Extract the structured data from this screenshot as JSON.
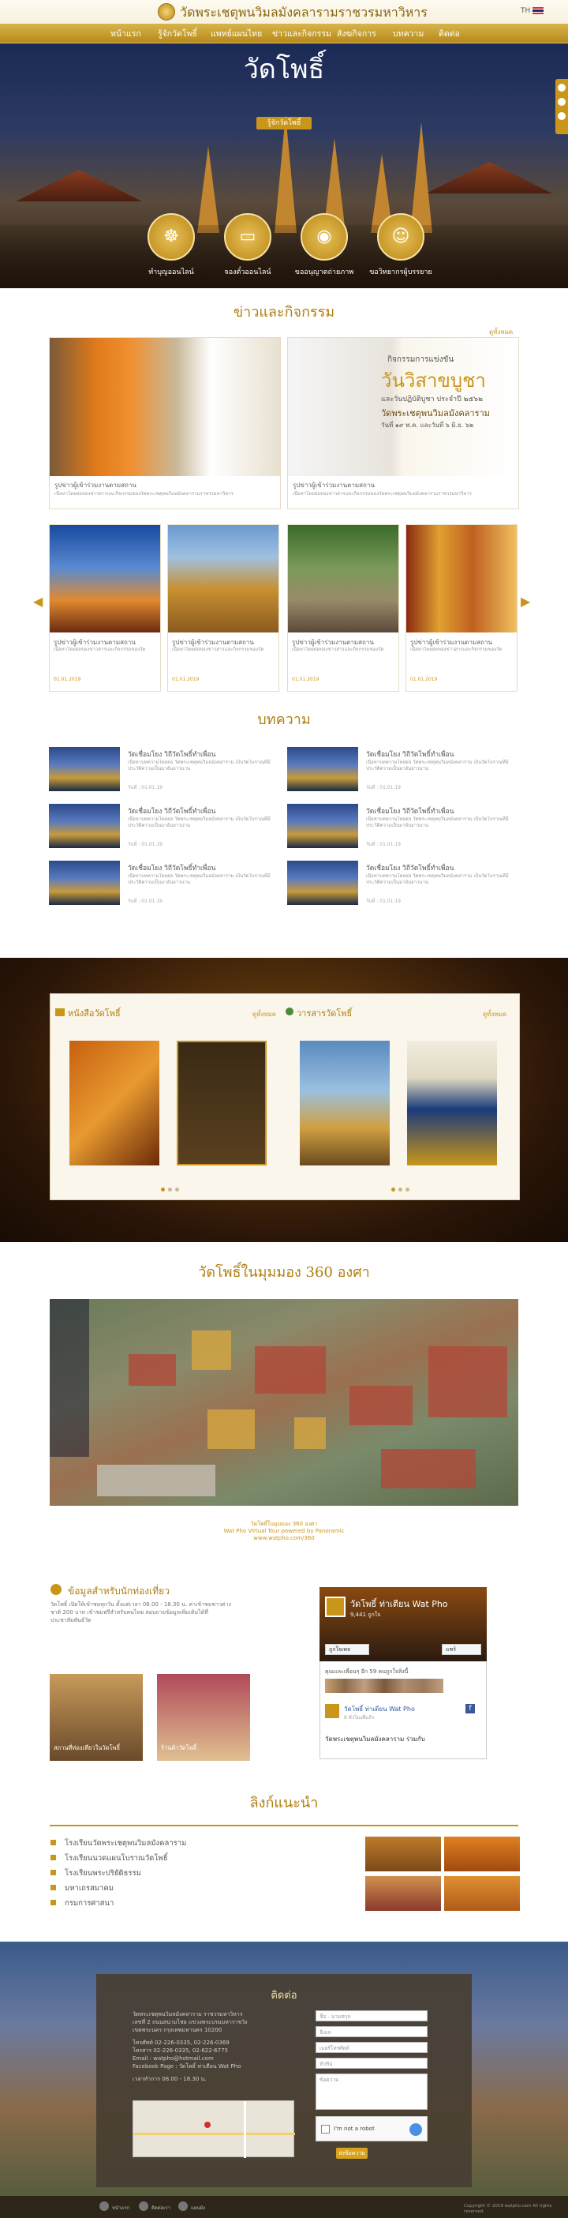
{
  "header": {
    "site_title": "วัดพระเชตุพนวิมลมังคลารามราชวรมหาวิหาร",
    "lang": "TH"
  },
  "nav": [
    "หน้าแรก",
    "รู้จักวัดโพธิ์",
    "แพทย์แผนไทย",
    "ข่าวและกิจกรรม",
    "สังฆกิจการ",
    "บทความ",
    "ติดต่อ"
  ],
  "hero": {
    "title": "วัดโพธิ์",
    "subtitle": "รู้จักวัดโพธิ์",
    "buttons": [
      {
        "label": "ทำบุญออนไลน์",
        "icon": "buddha-icon"
      },
      {
        "label": "จองตั๋วออนไลน์",
        "icon": "ticket-icon"
      },
      {
        "label": "ขออนุญาตถ่ายภาพ",
        "icon": "camera-icon"
      },
      {
        "label": "ขอวิทยากรผู้บรรยาย",
        "icon": "guide-icon"
      }
    ]
  },
  "news": {
    "title": "ข่าวและกิจกรรม",
    "more": "ดูทั้งหมด",
    "featured": [
      {
        "caption": "รูปข่าวผู้เข้าร่วมงานตามสถาน",
        "text": "เนื้อหาโดยย่อของข่าวสารและกิจกรรมของวัดพระเชตุพนวิมลมังคลารามราชวรมหาวิหาร",
        "banner_top": "กิจกรรมการแข่งขัน",
        "banner_main": "วันวิสาขบูชา",
        "banner_sub": "และวันปฏิบัติบูชา ประจำปี ๒๕๖๒",
        "banner_temple": "วัดพระเชตุพนวิมลมังคลาราม",
        "banner_date": "วันที่ ๑๙ พ.ค. และวันที่ ๖ มิ.ย. ๖๒"
      },
      {
        "caption": "รูปข่าวผู้เข้าร่วมงานตามสถาน",
        "text": "เนื้อหาโดยย่อของข่าวสารและกิจกรรมของวัดพระเชตุพนวิมลมังคลารามราชวรมหาวิหาร"
      }
    ],
    "items": [
      {
        "caption": "รูปข่าวผู้เข้าร่วมงานตามสถาน",
        "text": "เนื้อหาโดยย่อของข่าวสารและกิจกรรมของวัด",
        "date": "01.01.2019"
      },
      {
        "caption": "รูปข่าวผู้เข้าร่วมงานตามสถาน",
        "text": "เนื้อหาโดยย่อของข่าวสารและกิจกรรมของวัด",
        "date": "01.01.2019"
      },
      {
        "caption": "รูปข่าวผู้เข้าร่วมงานตามสถาน",
        "text": "เนื้อหาโดยย่อของข่าวสารและกิจกรรมของวัด",
        "date": "01.01.2019"
      },
      {
        "caption": "รูปข่าวผู้เข้าร่วมงานตามสถาน",
        "text": "เนื้อหาโดยย่อของข่าวสารและกิจกรรมของวัด",
        "date": "01.01.2019"
      }
    ]
  },
  "articles": {
    "title": "บทความ",
    "items": [
      {
        "title": "วัดเชื่อมโยง วิถีวัดโพธิ์ทำเพื่อน",
        "text": "เนื้อหาบทความโดยย่อ วัดพระเชตุพนวิมลมังคลาราม เป็นวัดโบราณที่มีประวัติความเป็นมาอันยาวนาน",
        "meta": "วันที่ : 01.01.19"
      },
      {
        "title": "วัดเชื่อมโยง วิถีวัดโพธิ์ทำเพื่อน",
        "text": "เนื้อหาบทความโดยย่อ วัดพระเชตุพนวิมลมังคลาราม เป็นวัดโบราณที่มีประวัติความเป็นมาอันยาวนาน",
        "meta": "วันที่ : 01.01.19"
      },
      {
        "title": "วัดเชื่อมโยง วิถีวัดโพธิ์ทำเพื่อน",
        "text": "เนื้อหาบทความโดยย่อ วัดพระเชตุพนวิมลมังคลาราม เป็นวัดโบราณที่มีประวัติความเป็นมาอันยาวนาน",
        "meta": "วันที่ : 01.01.19"
      },
      {
        "title": "วัดเชื่อมโยง วิถีวัดโพธิ์ทำเพื่อน",
        "text": "เนื้อหาบทความโดยย่อ วัดพระเชตุพนวิมลมังคลาราม เป็นวัดโบราณที่มีประวัติความเป็นมาอันยาวนาน",
        "meta": "วันที่ : 01.01.19"
      },
      {
        "title": "วัดเชื่อมโยง วิถีวัดโพธิ์ทำเพื่อน",
        "text": "เนื้อหาบทความโดยย่อ วัดพระเชตุพนวิมลมังคลาราม เป็นวัดโบราณที่มีประวัติความเป็นมาอันยาวนาน",
        "meta": "วันที่ : 01.01.19"
      },
      {
        "title": "วัดเชื่อมโยง วิถีวัดโพธิ์ทำเพื่อน",
        "text": "เนื้อหาบทความโดยย่อ วัดพระเชตุพนวิมลมังคลาราม เป็นวัดโบราณที่มีประวัติความเป็นมาอันยาวนาน",
        "meta": "วันที่ : 01.01.19"
      }
    ]
  },
  "books": {
    "tab1": "หนังสือวัดโพธิ์",
    "tab2": "วารสารวัดโพธิ์",
    "more": "ดูทั้งหมด"
  },
  "tour360": {
    "title": "วัดโพธิ์ในมุมมอง 360 องศา",
    "note1": "วัดโพธิ์ในมุมมอง 360 องศา",
    "note2": "Wat Pho Virtual Tour powered by Panoramic",
    "note3": "www.watpho.com/360"
  },
  "info": {
    "title": "ข้อมูลสำหรับนักท่องเที่ยว",
    "text": "วัดโพธิ์ เปิดให้เข้าชมทุกวัน ตั้งแต่เวลา 08.00 - 18.30 น. ค่าเข้าชมชาวต่างชาติ 200 บาท เข้าชมฟรีสำหรับคนไทย สอบถามข้อมูลเพิ่มเติมได้ที่ประชาสัมพันธ์วัด",
    "cards": [
      "สถานที่ท่องเที่ยวในวัดโพธิ์",
      "ร้านค้าวัดโพธิ์"
    ]
  },
  "facebook": {
    "page_name": "วัดโพธิ์ ท่าเตียน Wat Pho",
    "likes": "9,441 ถูกใจ",
    "like_btn": "ถูกใจเพจ",
    "share_btn": "แชร์",
    "friends": "คุณและเพื่อนๆ อีก 59 คนถูกใจสิ่งนี้",
    "post_name": "วัดโพธิ์ ท่าเตียน Wat Pho",
    "post_time": "6 ชั่วโมงที่แล้ว",
    "post_text": "วัดพระเชตุพนวิมลมังคลาราม ร่วมกับ"
  },
  "links": {
    "title": "ลิงก์แนะนำ",
    "items": [
      "โรงเรียนวัดพระเชตุพนวิมลมังคลาราม",
      "โรงเรียนนวดแผนโบราณวัดโพธิ์",
      "โรงเรียนพระปริยัติธรรม",
      "มหาเถรสมาคม",
      "กรมการศาสนา"
    ]
  },
  "contact": {
    "title": "ติดต่อ",
    "lines": [
      "วัดพระเชตุพนวิมลมังคลาราม ราชวรมหาวิหาร",
      "เลขที่ 2 ถนนสนามไชย แขวงพระบรมมหาราชวัง",
      "เขตพระนคร กรุงเทพมหานคร 10200",
      "โทรศัพท์ 02-226-0335, 02-226-0369",
      "โทรสาร 02-226-0335, 02-622-6775",
      "Email : watpho@hotmail.com",
      "Facebook Page : วัดโพธิ์ ท่าเตียน Wat Pho",
      "เวลาทำการ 08.00 - 18.30 น."
    ],
    "form": {
      "name": "ชื่อ - นามสกุล",
      "email": "อีเมล",
      "phone": "เบอร์โทรศัพท์",
      "subject": "หัวข้อ",
      "message": "ข้อความ",
      "captcha": "I'm not a robot",
      "send": "ส่งข้อความ"
    }
  },
  "footer": {
    "items": [
      "หน้าแรก",
      "ติดต่อเรา",
      "แผนผัง"
    ],
    "copyright": "Copyright © 2019 watpho.com All rights reserved."
  },
  "colors": {
    "gold": "#c9961a",
    "dark_gold": "#b07f10",
    "nav": "#c9961a"
  }
}
